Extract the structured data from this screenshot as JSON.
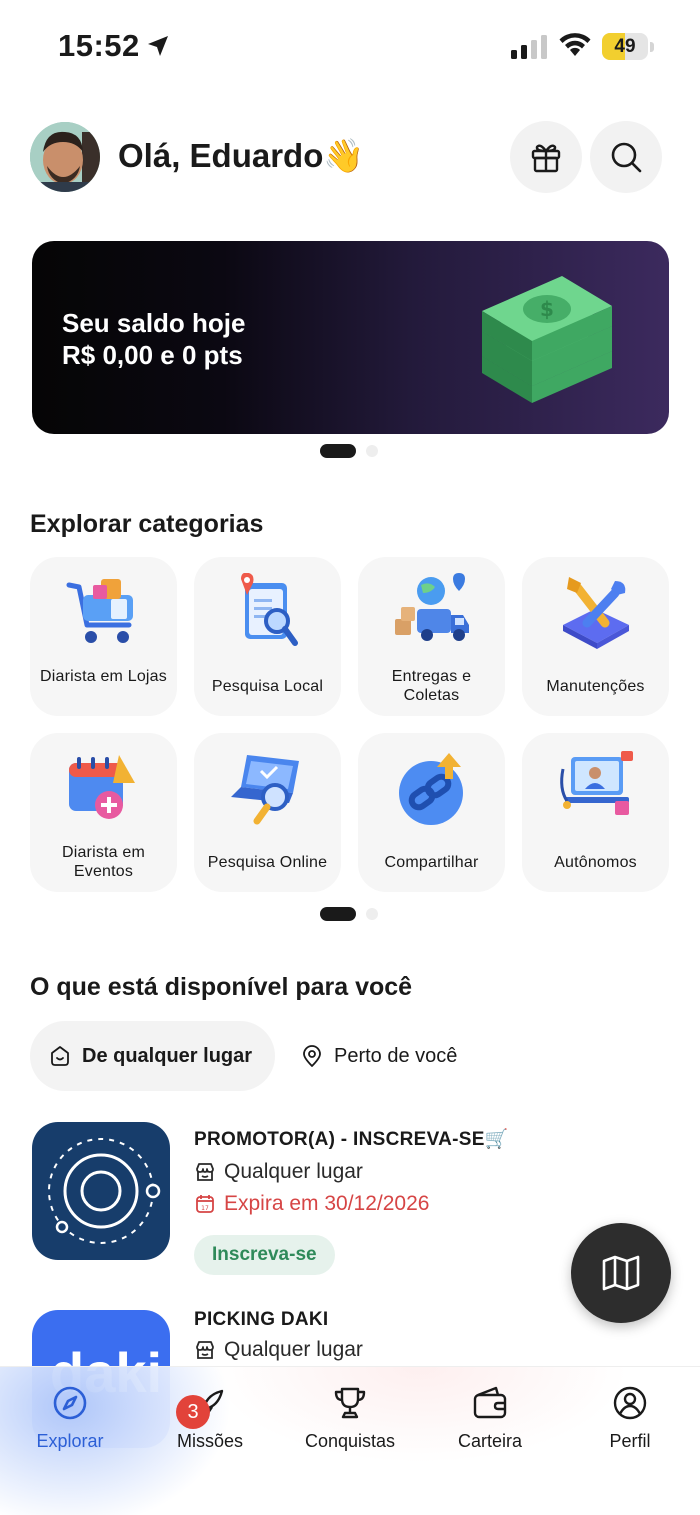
{
  "status_bar": {
    "time": "15:52",
    "battery_level": "49",
    "battery_fraction": 0.49
  },
  "header": {
    "greeting": "Olá, Eduardo👋"
  },
  "balance_banner": {
    "line1": "Seu saldo hoje",
    "line2": "R$ 0,00 e 0 pts"
  },
  "categories": {
    "title": "Explorar categorias",
    "items": [
      {
        "label": "Diarista em Lojas",
        "icon": "shopping-cart-icon"
      },
      {
        "label": "Pesquisa Local",
        "icon": "clipboard-search-icon"
      },
      {
        "label": "Entregas e Coletas",
        "icon": "delivery-truck-icon"
      },
      {
        "label": "Manutenções",
        "icon": "tools-icon"
      },
      {
        "label": "Diarista em Eventos",
        "icon": "event-calendar-icon"
      },
      {
        "label": "Pesquisa Online",
        "icon": "laptop-search-icon"
      },
      {
        "label": "Compartilhar",
        "icon": "share-link-icon"
      },
      {
        "label": "Autônomos",
        "icon": "freelancer-icon"
      }
    ]
  },
  "available": {
    "title": "O que está disponível para você",
    "filter_any": "De qualquer lugar",
    "filter_near": "Perto de você"
  },
  "opportunities": [
    {
      "title": "PROMOTOR(A) - INSCREVA-SE🛒",
      "location": "Qualquer lugar",
      "expires": "Expira em 30/12/2026",
      "badge": "Inscreva-se"
    },
    {
      "title": "PICKING DAKI",
      "location": "Qualquer lugar",
      "logo_text": "daki"
    }
  ],
  "nav": {
    "items": [
      {
        "label": "Explorar",
        "icon": "compass-icon"
      },
      {
        "label": "Missões",
        "icon": "rocket-icon",
        "badge": "3"
      },
      {
        "label": "Conquistas",
        "icon": "trophy-icon"
      },
      {
        "label": "Carteira",
        "icon": "wallet-icon"
      },
      {
        "label": "Perfil",
        "icon": "profile-icon"
      }
    ]
  },
  "colors": {
    "accent": "#2c5fd6",
    "expire": "#d64545",
    "badge_green": "#2f8a5a",
    "notification": "#e2433a"
  }
}
